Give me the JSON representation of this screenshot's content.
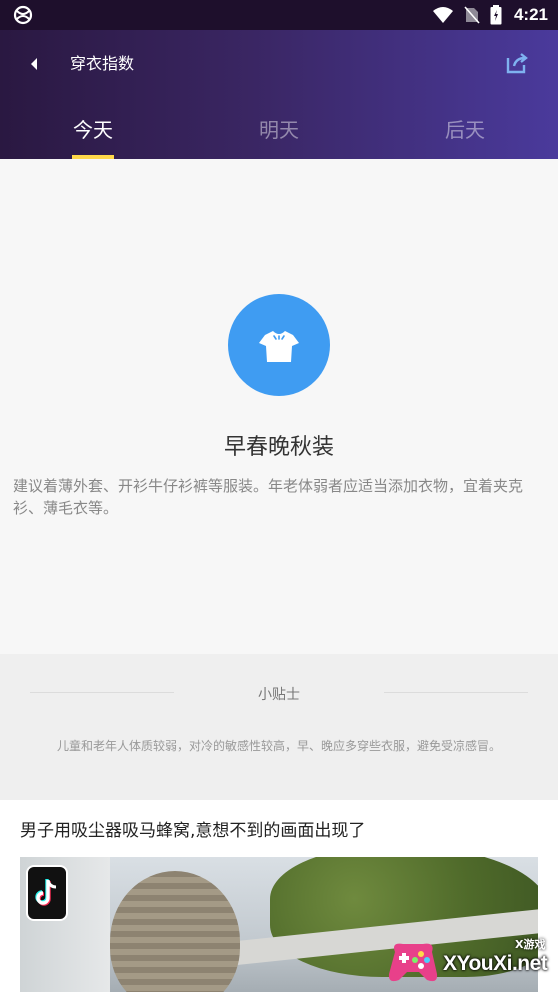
{
  "status": {
    "time": "4:21"
  },
  "header": {
    "title": "穿衣指数"
  },
  "tabs": [
    {
      "label": "今天",
      "active": true
    },
    {
      "label": "明天",
      "active": false
    },
    {
      "label": "后天",
      "active": false
    }
  ],
  "clothing": {
    "icon": "tshirt-icon",
    "icon_color": "#3f9cf2",
    "title": "早春晚秋装",
    "description": "建议着薄外套、开衫牛仔衫裤等服装。年老体弱者应适当添加衣物，宜着夹克衫、薄毛衣等。"
  },
  "tips": {
    "title": "小贴士",
    "text": "儿童和老年人体质较弱，对冷的敏感性较高，早、晚应多穿些衣服，避免受凉感冒。"
  },
  "news": {
    "title": "男子用吸尘器吸马蜂窝,意想不到的画面出现了"
  },
  "watermark": {
    "text": "XYouXi.net",
    "small": "X游戏"
  },
  "colors": {
    "accent": "#ffd84a",
    "header_start": "#2a1841",
    "header_end": "#4a3a9c"
  }
}
